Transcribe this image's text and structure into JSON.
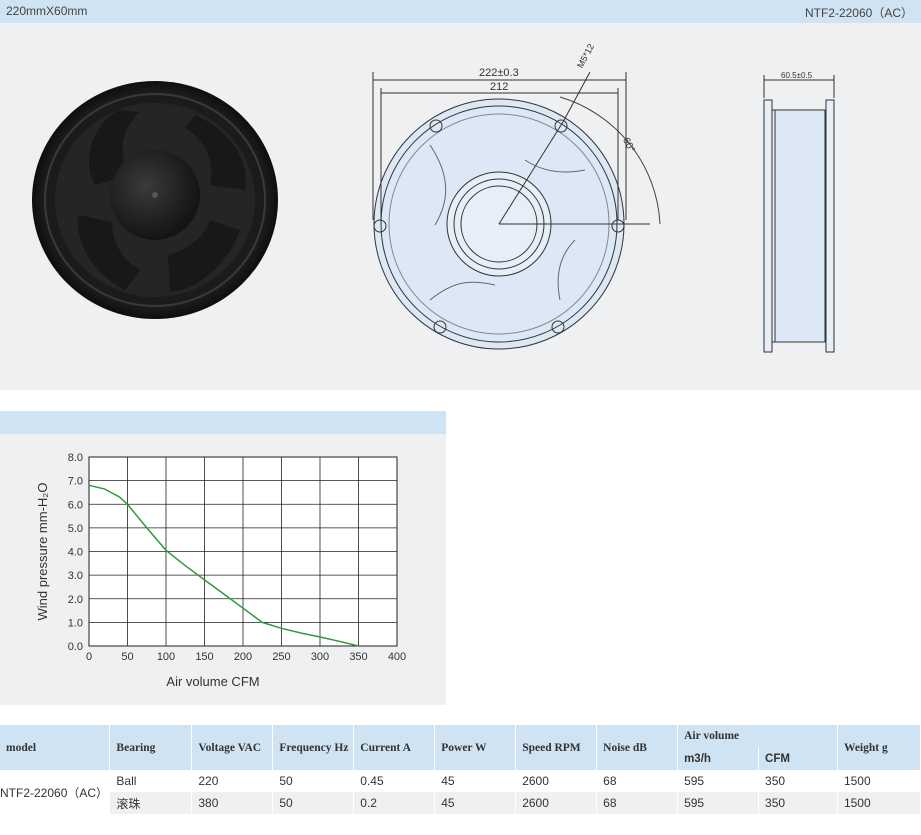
{
  "header": {
    "size": "220mmX60mm",
    "model_code": "NTF2-22060（AC）"
  },
  "drawing": {
    "dim_outer": "222±0.3",
    "dim_inner": "212",
    "dim_hole": "M5*12",
    "dim_angle": "60°",
    "dim_depth": "60.5±0.5"
  },
  "chart_data": {
    "type": "line",
    "xlabel": "Air volume CFM",
    "ylabel": "Wind pressure mm-H₂O",
    "xlim": [
      0,
      400
    ],
    "ylim": [
      0,
      8
    ],
    "x_ticks": [
      "0",
      "50",
      "100",
      "150",
      "200",
      "250",
      "300",
      "350",
      "400"
    ],
    "y_ticks": [
      "0.0",
      "1.0",
      "2.0",
      "3.0",
      "4.0",
      "5.0",
      "6.0",
      "7.0",
      "8.0"
    ],
    "grid": true,
    "series": [
      {
        "color": "#2e9b3a",
        "points": [
          [
            0,
            6.8
          ],
          [
            20,
            6.65
          ],
          [
            40,
            6.3
          ],
          [
            50,
            6.0
          ],
          [
            75,
            5.0
          ],
          [
            100,
            4.05
          ],
          [
            125,
            3.4
          ],
          [
            150,
            2.8
          ],
          [
            175,
            2.2
          ],
          [
            200,
            1.6
          ],
          [
            225,
            1.0
          ],
          [
            250,
            0.75
          ],
          [
            275,
            0.55
          ],
          [
            300,
            0.38
          ],
          [
            325,
            0.2
          ],
          [
            350,
            0.0
          ]
        ]
      }
    ]
  },
  "table": {
    "headers": {
      "model": "model",
      "bearing": "Bearing",
      "voltage": "Voltage VAC",
      "frequency": "Frequency Hz",
      "current": "Current A",
      "power": "Power W",
      "speed": "Speed RPM",
      "noise": "Noise dB",
      "air_volume": "Air volume",
      "m3h": "m3/h",
      "cfm": "CFM",
      "weight": "Weight g"
    },
    "model_name": "NTF2-22060（AC）",
    "rows": [
      {
        "bearing": "Ball",
        "voltage": "220",
        "frequency": "50",
        "current": "0.45",
        "power": "45",
        "speed": "2600",
        "noise": "68",
        "m3h": "595",
        "cfm": "350",
        "weight": "1500"
      },
      {
        "bearing": "滚珠",
        "voltage": "380",
        "frequency": "50",
        "current": "0.2",
        "power": "45",
        "speed": "2600",
        "noise": "68",
        "m3h": "595",
        "cfm": "350",
        "weight": "1500"
      }
    ]
  }
}
